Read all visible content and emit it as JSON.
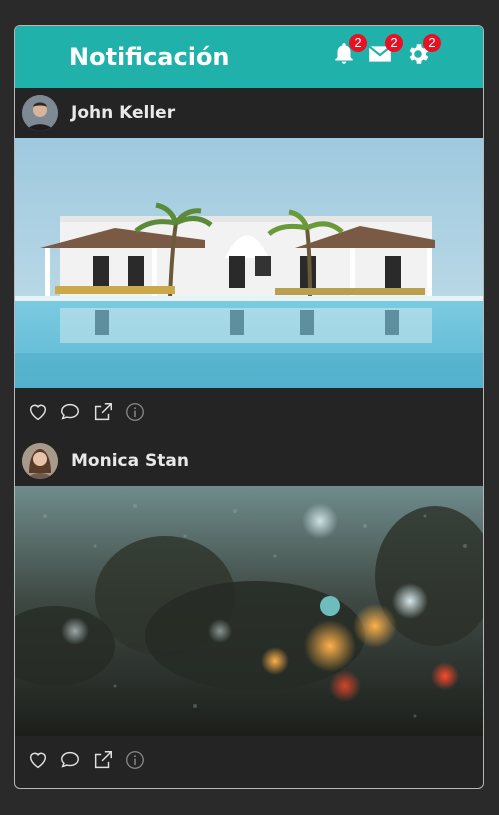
{
  "header": {
    "title": "Notificación",
    "notifications_count": "2",
    "messages_count": "2",
    "settings_count": "2"
  },
  "colors": {
    "header_bg": "#20b2aa",
    "badge_bg": "#e81123",
    "card_bg": "#242424",
    "page_bg": "#2a2a2a"
  },
  "posts": [
    {
      "user": "John Keller",
      "image": "white resort building with pool and palm trees",
      "actions": [
        "heart-icon",
        "comment-icon",
        "share-icon",
        "info-icon"
      ]
    },
    {
      "user": "Monica Stan",
      "image": "rainy window with blurred night lights",
      "actions": [
        "heart-icon",
        "comment-icon",
        "share-icon",
        "info-icon"
      ]
    }
  ]
}
